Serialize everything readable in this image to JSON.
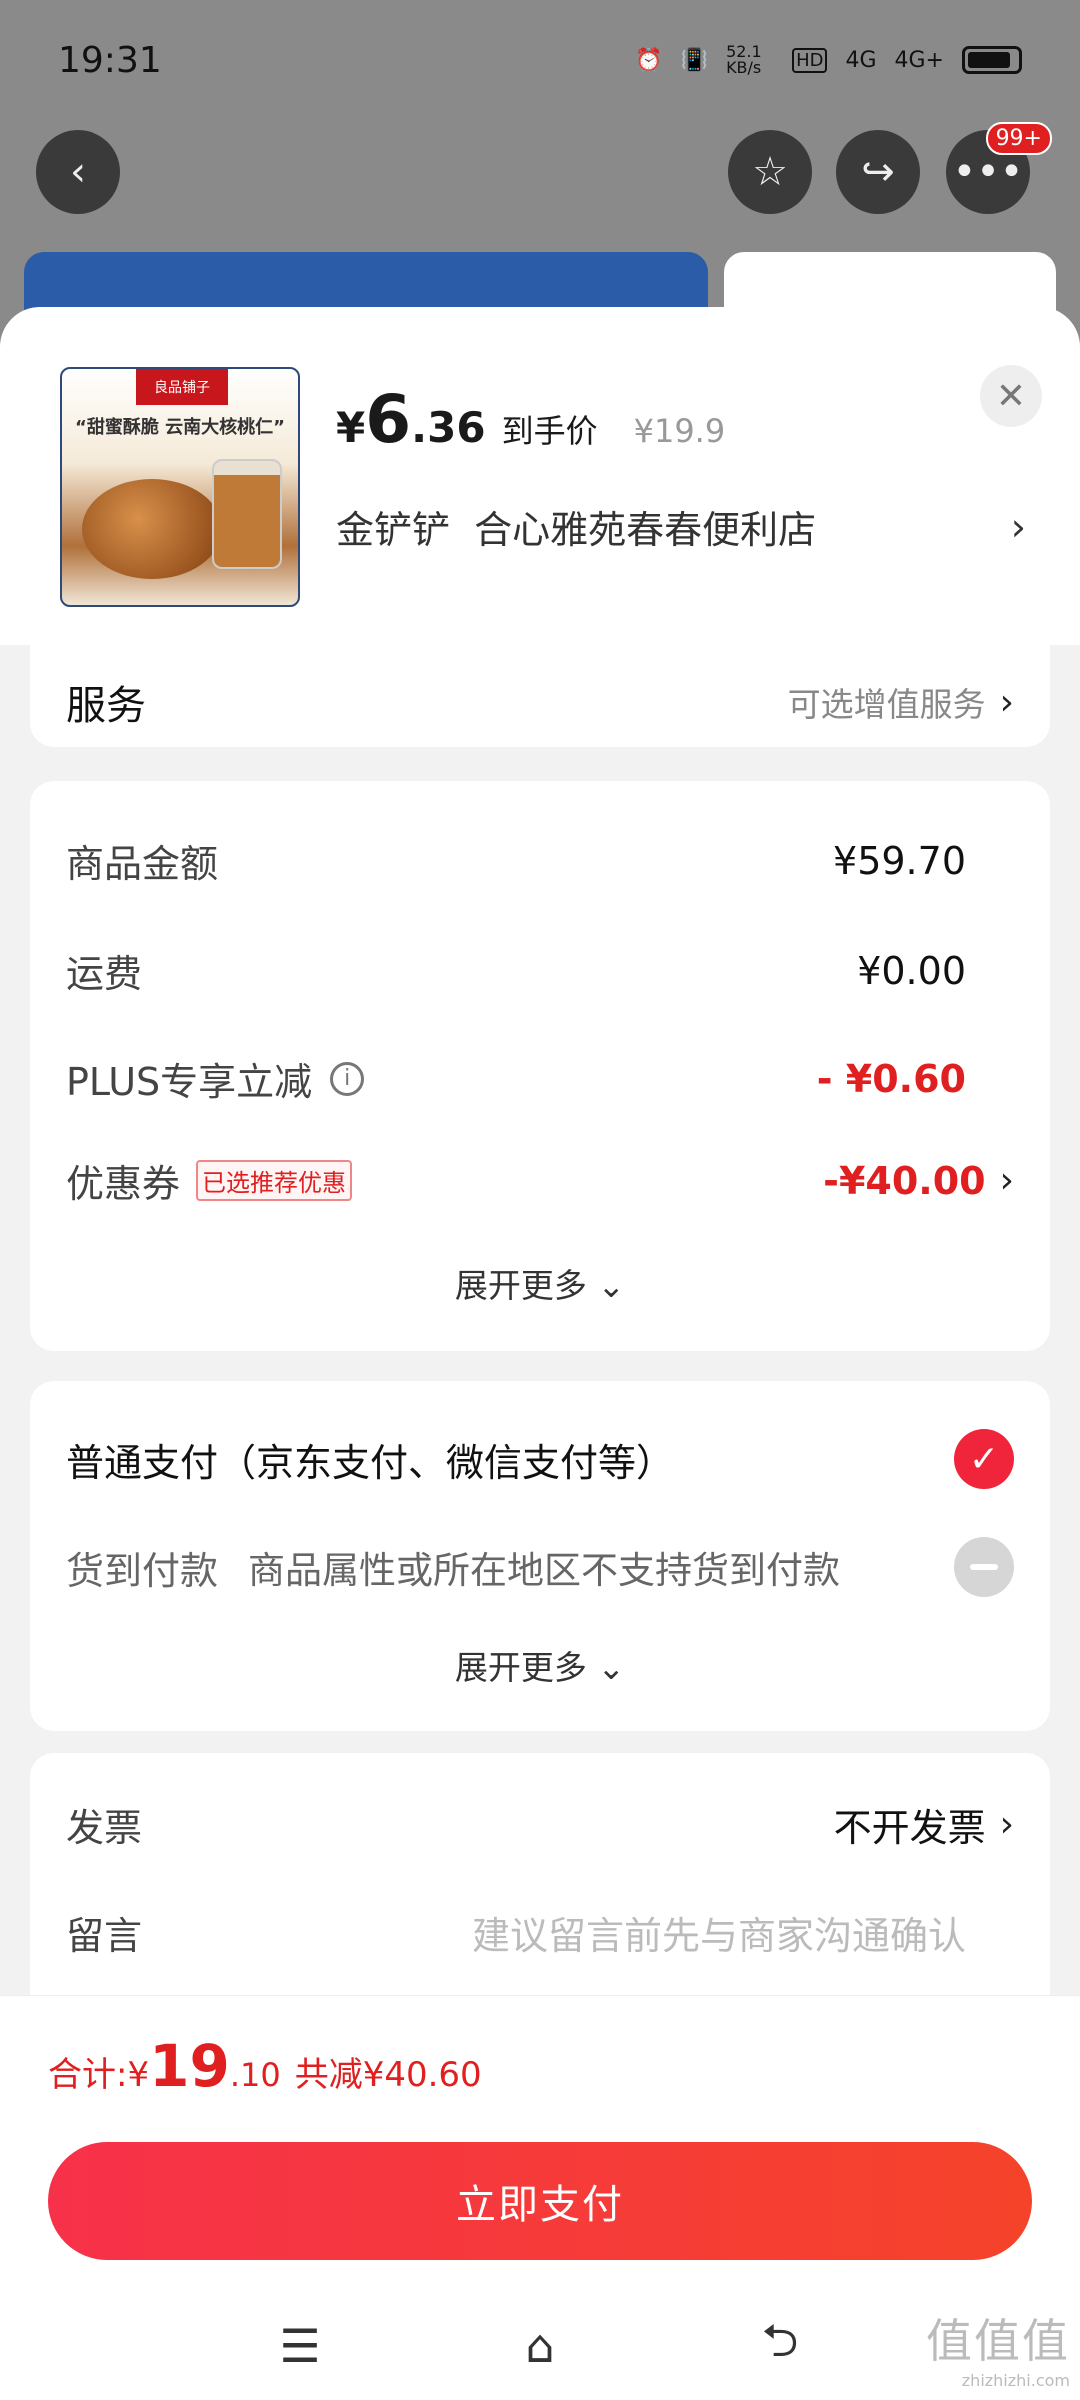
{
  "status_bar": {
    "time": "19:31",
    "net_speed": "52.1 KB/s",
    "hd_label": "HD",
    "signal1": "4G",
    "signal2": "4G+"
  },
  "top_nav": {
    "badge": "99+"
  },
  "product": {
    "thumb_brand": "良品铺子",
    "thumb_slogan": "“甜蜜酥脆 云南大核桃仁”",
    "price_currency": "¥",
    "price_int": "6",
    "price_dec": ".36",
    "price_tag": "到手价",
    "original_price": "¥19.9",
    "store": "金铲铲  合心雅苑春春便利店"
  },
  "service": {
    "label": "服务",
    "value": "可选增值服务"
  },
  "amounts": {
    "goods_label": "商品金额",
    "goods_value": "¥59.70",
    "shipping_label": "运费",
    "shipping_value": "¥0.00",
    "plus_label": "PLUS专享立减",
    "plus_value": "- ¥0.60",
    "coupon_label": "优惠券",
    "coupon_tag": "已选推荐优惠",
    "coupon_value": "-¥40.00",
    "expand": "展开更多"
  },
  "payment": {
    "normal": "普通支付（京东支付、微信支付等）",
    "cod_label": "货到付款",
    "cod_note": "商品属性或所在地区不支持货到付款",
    "expand": "展开更多"
  },
  "invoice": {
    "label": "发票",
    "value": "不开发票",
    "message_label": "留言",
    "message_placeholder": "建议留言前先与商家沟通确认"
  },
  "total": {
    "label": "合计: ",
    "currency": "¥",
    "int": "19",
    "dec": ".10",
    "saved": "共减¥40.60"
  },
  "pay_button": "立即支付",
  "watermark": {
    "main": "值值值",
    "sub": "zhizhizhi.com"
  },
  "colors": {
    "accent": "#e02020",
    "button_start": "#f7314a",
    "button_end": "#f5432a"
  }
}
